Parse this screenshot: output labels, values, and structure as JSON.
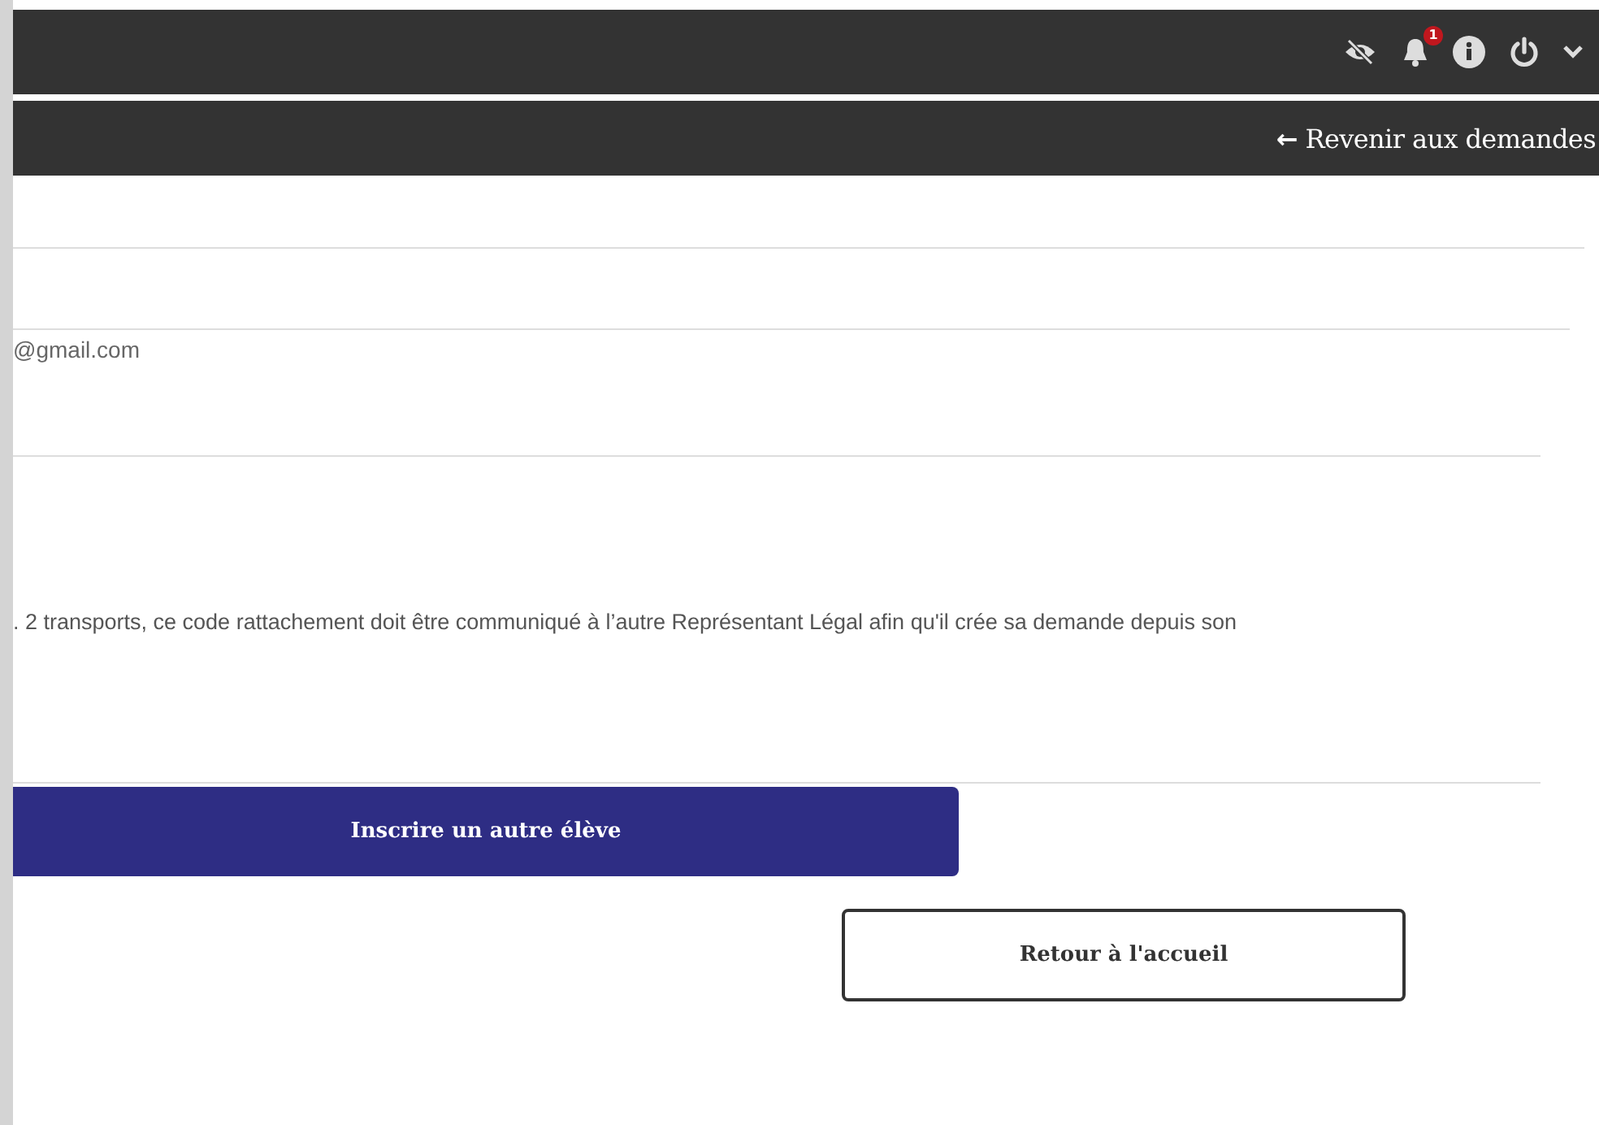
{
  "top_bar": {
    "notification_count": "1"
  },
  "sub_bar": {
    "back_link": {
      "arrow": "←",
      "label": "Revenir aux demandes"
    }
  },
  "content": {
    "email": "@gmail.com",
    "info_text": ". 2 transports, ce code rattachement doit être communiqué à l’autre Représentant Légal afin qu'il crée sa demande depuis son",
    "buttons": [
      {
        "kind": "primary",
        "label": "Inscrire un autre élève"
      },
      {
        "kind": "outline",
        "label": "Retour à l'accueil"
      }
    ]
  }
}
